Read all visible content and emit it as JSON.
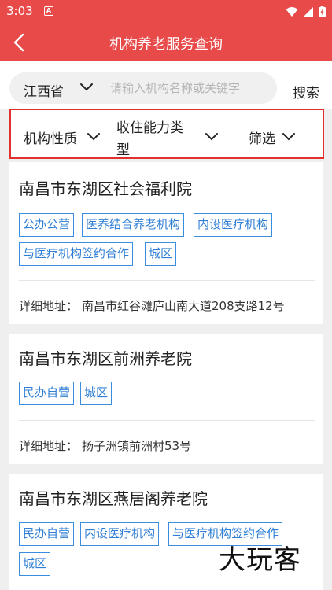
{
  "status_bar": {
    "time": "3:03",
    "notif_icon": "A"
  },
  "nav": {
    "title": "机构养老服务查询"
  },
  "search": {
    "province": "江西省",
    "placeholder": "请输入机构名称或关键字",
    "button": "搜索"
  },
  "filters": {
    "nature": "机构性质",
    "capacity_line1": "收住能力类",
    "capacity_line2": "型",
    "screen": "筛选"
  },
  "address_label": "详细地址：",
  "cards": [
    {
      "name": "南昌市东湖区社会福利院",
      "tags": [
        "公办公营",
        "医养结合养老机构",
        "内设医疗机构",
        "与医疗机构签约合作",
        "城区"
      ],
      "address": "南昌市红谷滩庐山南大道208支路12号"
    },
    {
      "name": "南昌市东湖区前洲养老院",
      "tags": [
        "民办自营",
        "城区"
      ],
      "address": "扬子洲镇前洲村53号"
    },
    {
      "name": "南昌市东湖区燕居阁养老院",
      "tags": [
        "民办自营",
        "内设医疗机构",
        "与医疗机构签约合作",
        "城区"
      ]
    }
  ],
  "watermark": "大玩客",
  "colors": {
    "header": "#e84a4a",
    "tag": "#2f7fd6",
    "highlight_border": "#e03030"
  }
}
